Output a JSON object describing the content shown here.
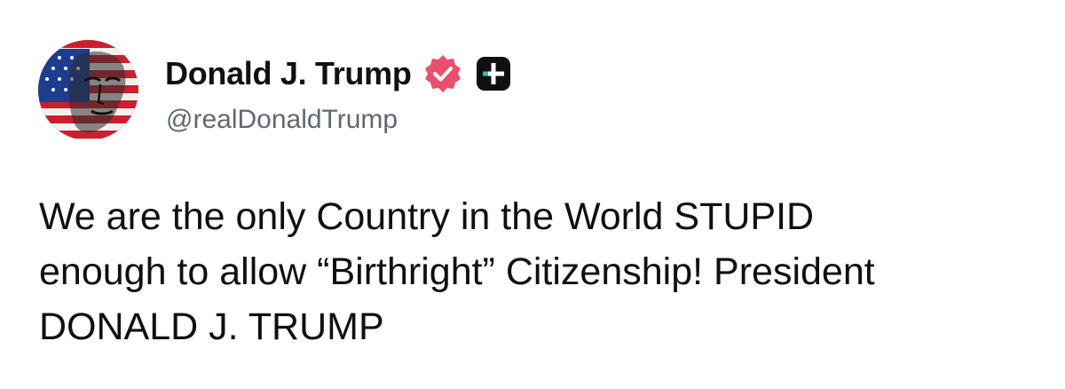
{
  "author": {
    "display_name": "Donald J. Trump",
    "handle": "@realDonaldTrump",
    "avatar_icon": "flag-portrait-avatar",
    "verified_badge_icon": "verified-badge-icon",
    "plus_badge_icon": "plus-badge-icon"
  },
  "post": {
    "text": "We are the only Country in the World STUPID\nenough to allow “Birthright” Citizenship! President\nDONALD J. TRUMP"
  },
  "colors": {
    "verified_badge": "#ea4f6e",
    "plus_badge_bg": "#0f0f14",
    "plus_badge_accent": "#2ec4a5",
    "handle": "#606770",
    "text": "#0f0f14"
  }
}
